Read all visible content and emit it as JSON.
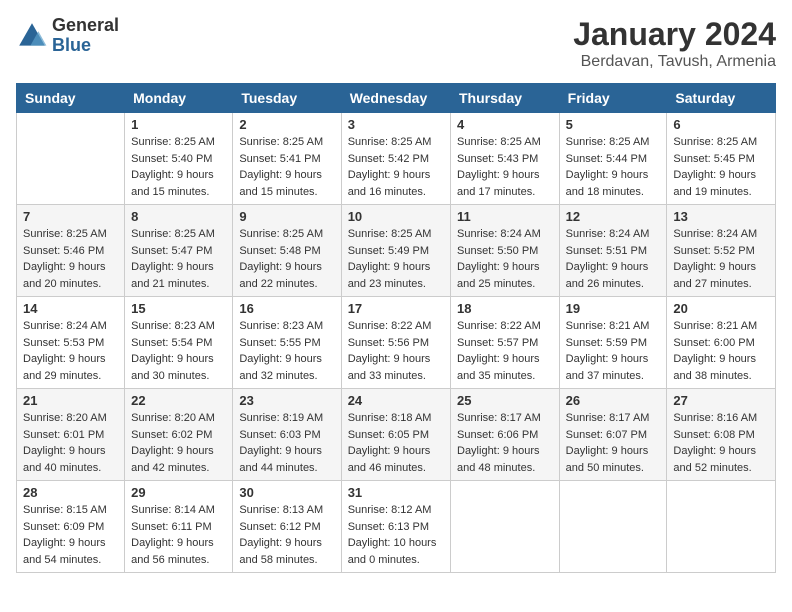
{
  "header": {
    "logo": {
      "general": "General",
      "blue": "Blue"
    },
    "title": "January 2024",
    "location": "Berdavan, Tavush, Armenia"
  },
  "days_header": [
    "Sunday",
    "Monday",
    "Tuesday",
    "Wednesday",
    "Thursday",
    "Friday",
    "Saturday"
  ],
  "weeks": [
    [
      {
        "day": "",
        "info": ""
      },
      {
        "day": "1",
        "info": "Sunrise: 8:25 AM\nSunset: 5:40 PM\nDaylight: 9 hours\nand 15 minutes."
      },
      {
        "day": "2",
        "info": "Sunrise: 8:25 AM\nSunset: 5:41 PM\nDaylight: 9 hours\nand 15 minutes."
      },
      {
        "day": "3",
        "info": "Sunrise: 8:25 AM\nSunset: 5:42 PM\nDaylight: 9 hours\nand 16 minutes."
      },
      {
        "day": "4",
        "info": "Sunrise: 8:25 AM\nSunset: 5:43 PM\nDaylight: 9 hours\nand 17 minutes."
      },
      {
        "day": "5",
        "info": "Sunrise: 8:25 AM\nSunset: 5:44 PM\nDaylight: 9 hours\nand 18 minutes."
      },
      {
        "day": "6",
        "info": "Sunrise: 8:25 AM\nSunset: 5:45 PM\nDaylight: 9 hours\nand 19 minutes."
      }
    ],
    [
      {
        "day": "7",
        "info": "Sunrise: 8:25 AM\nSunset: 5:46 PM\nDaylight: 9 hours\nand 20 minutes."
      },
      {
        "day": "8",
        "info": "Sunrise: 8:25 AM\nSunset: 5:47 PM\nDaylight: 9 hours\nand 21 minutes."
      },
      {
        "day": "9",
        "info": "Sunrise: 8:25 AM\nSunset: 5:48 PM\nDaylight: 9 hours\nand 22 minutes."
      },
      {
        "day": "10",
        "info": "Sunrise: 8:25 AM\nSunset: 5:49 PM\nDaylight: 9 hours\nand 23 minutes."
      },
      {
        "day": "11",
        "info": "Sunrise: 8:24 AM\nSunset: 5:50 PM\nDaylight: 9 hours\nand 25 minutes."
      },
      {
        "day": "12",
        "info": "Sunrise: 8:24 AM\nSunset: 5:51 PM\nDaylight: 9 hours\nand 26 minutes."
      },
      {
        "day": "13",
        "info": "Sunrise: 8:24 AM\nSunset: 5:52 PM\nDaylight: 9 hours\nand 27 minutes."
      }
    ],
    [
      {
        "day": "14",
        "info": "Sunrise: 8:24 AM\nSunset: 5:53 PM\nDaylight: 9 hours\nand 29 minutes."
      },
      {
        "day": "15",
        "info": "Sunrise: 8:23 AM\nSunset: 5:54 PM\nDaylight: 9 hours\nand 30 minutes."
      },
      {
        "day": "16",
        "info": "Sunrise: 8:23 AM\nSunset: 5:55 PM\nDaylight: 9 hours\nand 32 minutes."
      },
      {
        "day": "17",
        "info": "Sunrise: 8:22 AM\nSunset: 5:56 PM\nDaylight: 9 hours\nand 33 minutes."
      },
      {
        "day": "18",
        "info": "Sunrise: 8:22 AM\nSunset: 5:57 PM\nDaylight: 9 hours\nand 35 minutes."
      },
      {
        "day": "19",
        "info": "Sunrise: 8:21 AM\nSunset: 5:59 PM\nDaylight: 9 hours\nand 37 minutes."
      },
      {
        "day": "20",
        "info": "Sunrise: 8:21 AM\nSunset: 6:00 PM\nDaylight: 9 hours\nand 38 minutes."
      }
    ],
    [
      {
        "day": "21",
        "info": "Sunrise: 8:20 AM\nSunset: 6:01 PM\nDaylight: 9 hours\nand 40 minutes."
      },
      {
        "day": "22",
        "info": "Sunrise: 8:20 AM\nSunset: 6:02 PM\nDaylight: 9 hours\nand 42 minutes."
      },
      {
        "day": "23",
        "info": "Sunrise: 8:19 AM\nSunset: 6:03 PM\nDaylight: 9 hours\nand 44 minutes."
      },
      {
        "day": "24",
        "info": "Sunrise: 8:18 AM\nSunset: 6:05 PM\nDaylight: 9 hours\nand 46 minutes."
      },
      {
        "day": "25",
        "info": "Sunrise: 8:17 AM\nSunset: 6:06 PM\nDaylight: 9 hours\nand 48 minutes."
      },
      {
        "day": "26",
        "info": "Sunrise: 8:17 AM\nSunset: 6:07 PM\nDaylight: 9 hours\nand 50 minutes."
      },
      {
        "day": "27",
        "info": "Sunrise: 8:16 AM\nSunset: 6:08 PM\nDaylight: 9 hours\nand 52 minutes."
      }
    ],
    [
      {
        "day": "28",
        "info": "Sunrise: 8:15 AM\nSunset: 6:09 PM\nDaylight: 9 hours\nand 54 minutes."
      },
      {
        "day": "29",
        "info": "Sunrise: 8:14 AM\nSunset: 6:11 PM\nDaylight: 9 hours\nand 56 minutes."
      },
      {
        "day": "30",
        "info": "Sunrise: 8:13 AM\nSunset: 6:12 PM\nDaylight: 9 hours\nand 58 minutes."
      },
      {
        "day": "31",
        "info": "Sunrise: 8:12 AM\nSunset: 6:13 PM\nDaylight: 10 hours\nand 0 minutes."
      },
      {
        "day": "",
        "info": ""
      },
      {
        "day": "",
        "info": ""
      },
      {
        "day": "",
        "info": ""
      }
    ]
  ]
}
